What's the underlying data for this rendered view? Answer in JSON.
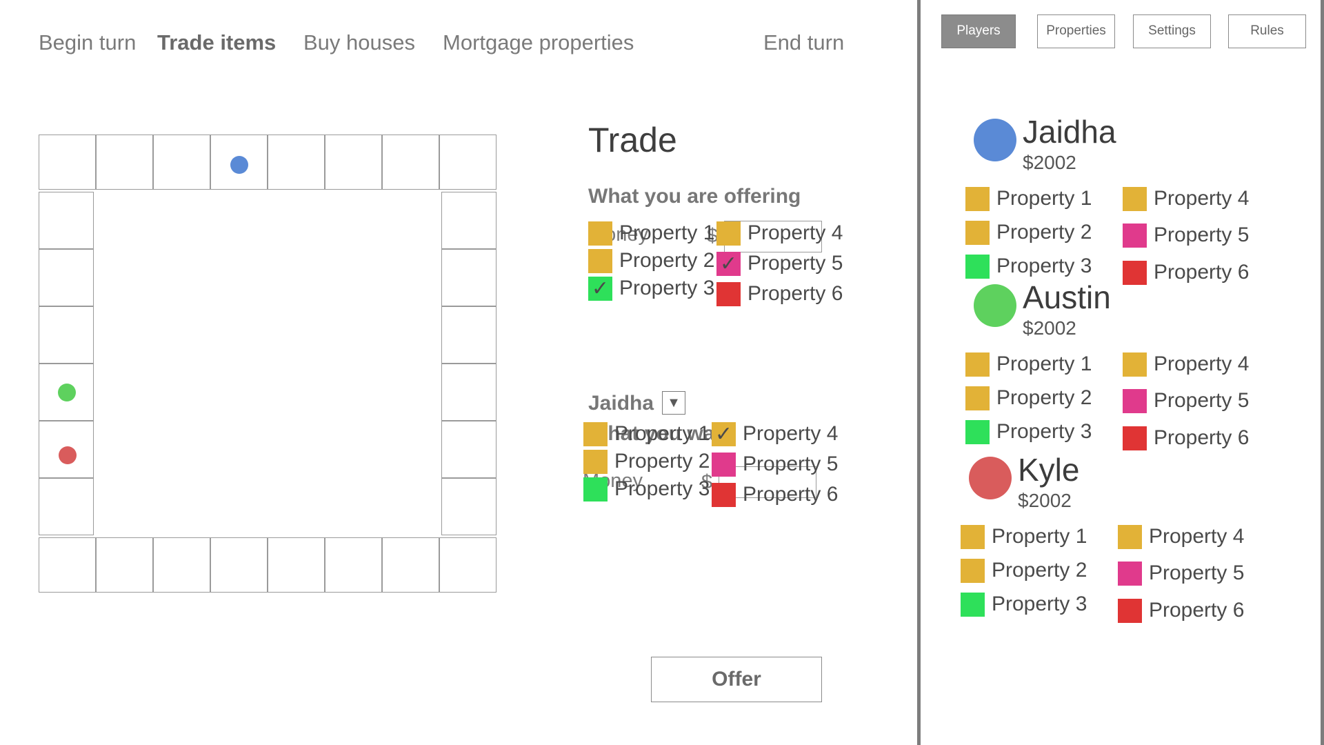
{
  "nav": {
    "begin_turn": "Begin turn",
    "trade_items": "Trade items",
    "buy_houses": "Buy houses",
    "mortgage": "Mortgage properties",
    "end_turn": "End turn"
  },
  "colors": {
    "yellow": "#e2b237",
    "green": "#2ee05a",
    "pink": "#e03a8c",
    "red": "#e03434",
    "blue_token": "#5a8ad6",
    "green_token": "#5ed15e",
    "red_token": "#d95c5c"
  },
  "board": {
    "tokens": [
      {
        "name": "blue-token",
        "color": "#5a8ad6"
      },
      {
        "name": "green-token",
        "color": "#5ed15e"
      },
      {
        "name": "red-token",
        "color": "#d95c5c"
      }
    ]
  },
  "trade": {
    "title": "Trade",
    "offering_heading": "What you are offering",
    "money_label": "Money",
    "currency": "$",
    "offer_money_value": "",
    "offer_props": [
      {
        "label": "Property 1",
        "color": "#e2b237",
        "checked": false
      },
      {
        "label": "Property 2",
        "color": "#e2b237",
        "checked": false
      },
      {
        "label": "Property 3",
        "color": "#2ee05a",
        "checked": true
      },
      {
        "label": "Property 4",
        "color": "#e2b237",
        "checked": false
      },
      {
        "label": "Property 5",
        "color": "#e03a8c",
        "checked": true
      },
      {
        "label": "Property 6",
        "color": "#e03434",
        "checked": false
      }
    ],
    "target_player": "Jaidha",
    "dropdown_icon": "▼",
    "want_heading": "What you want",
    "want_money_value": "",
    "want_props": [
      {
        "label": "Property 1",
        "color": "#e2b237",
        "checked": false
      },
      {
        "label": "Property 2",
        "color": "#e2b237",
        "checked": false
      },
      {
        "label": "Property 3",
        "color": "#2ee05a",
        "checked": false
      },
      {
        "label": "Property 4",
        "color": "#e2b237",
        "checked": true
      },
      {
        "label": "Property 5",
        "color": "#e03a8c",
        "checked": false
      },
      {
        "label": "Property 6",
        "color": "#e03434",
        "checked": false
      }
    ],
    "offer_button": "Offer"
  },
  "sidebar": {
    "tabs": [
      "Players",
      "Properties",
      "Settings",
      "Rules"
    ],
    "active_tab": "Players",
    "players": [
      {
        "name": "Jaidha",
        "money": "$2002",
        "color": "#5a8ad6",
        "props": [
          {
            "label": "Property 1",
            "color": "#e2b237"
          },
          {
            "label": "Property 2",
            "color": "#e2b237"
          },
          {
            "label": "Property 3",
            "color": "#2ee05a"
          },
          {
            "label": "Property 4",
            "color": "#e2b237"
          },
          {
            "label": "Property 5",
            "color": "#e03a8c"
          },
          {
            "label": "Property 6",
            "color": "#e03434"
          }
        ]
      },
      {
        "name": "Austin",
        "money": "$2002",
        "color": "#5ed15e",
        "props": [
          {
            "label": "Property 1",
            "color": "#e2b237"
          },
          {
            "label": "Property 2",
            "color": "#e2b237"
          },
          {
            "label": "Property 3",
            "color": "#2ee05a"
          },
          {
            "label": "Property 4",
            "color": "#e2b237"
          },
          {
            "label": "Property 5",
            "color": "#e03a8c"
          },
          {
            "label": "Property 6",
            "color": "#e03434"
          }
        ]
      },
      {
        "name": "Kyle",
        "money": "$2002",
        "color": "#d95c5c",
        "props": [
          {
            "label": "Property 1",
            "color": "#e2b237"
          },
          {
            "label": "Property 2",
            "color": "#e2b237"
          },
          {
            "label": "Property 3",
            "color": "#2ee05a"
          },
          {
            "label": "Property 4",
            "color": "#e2b237"
          },
          {
            "label": "Property 5",
            "color": "#e03a8c"
          },
          {
            "label": "Property 6",
            "color": "#e03434"
          }
        ]
      }
    ]
  }
}
